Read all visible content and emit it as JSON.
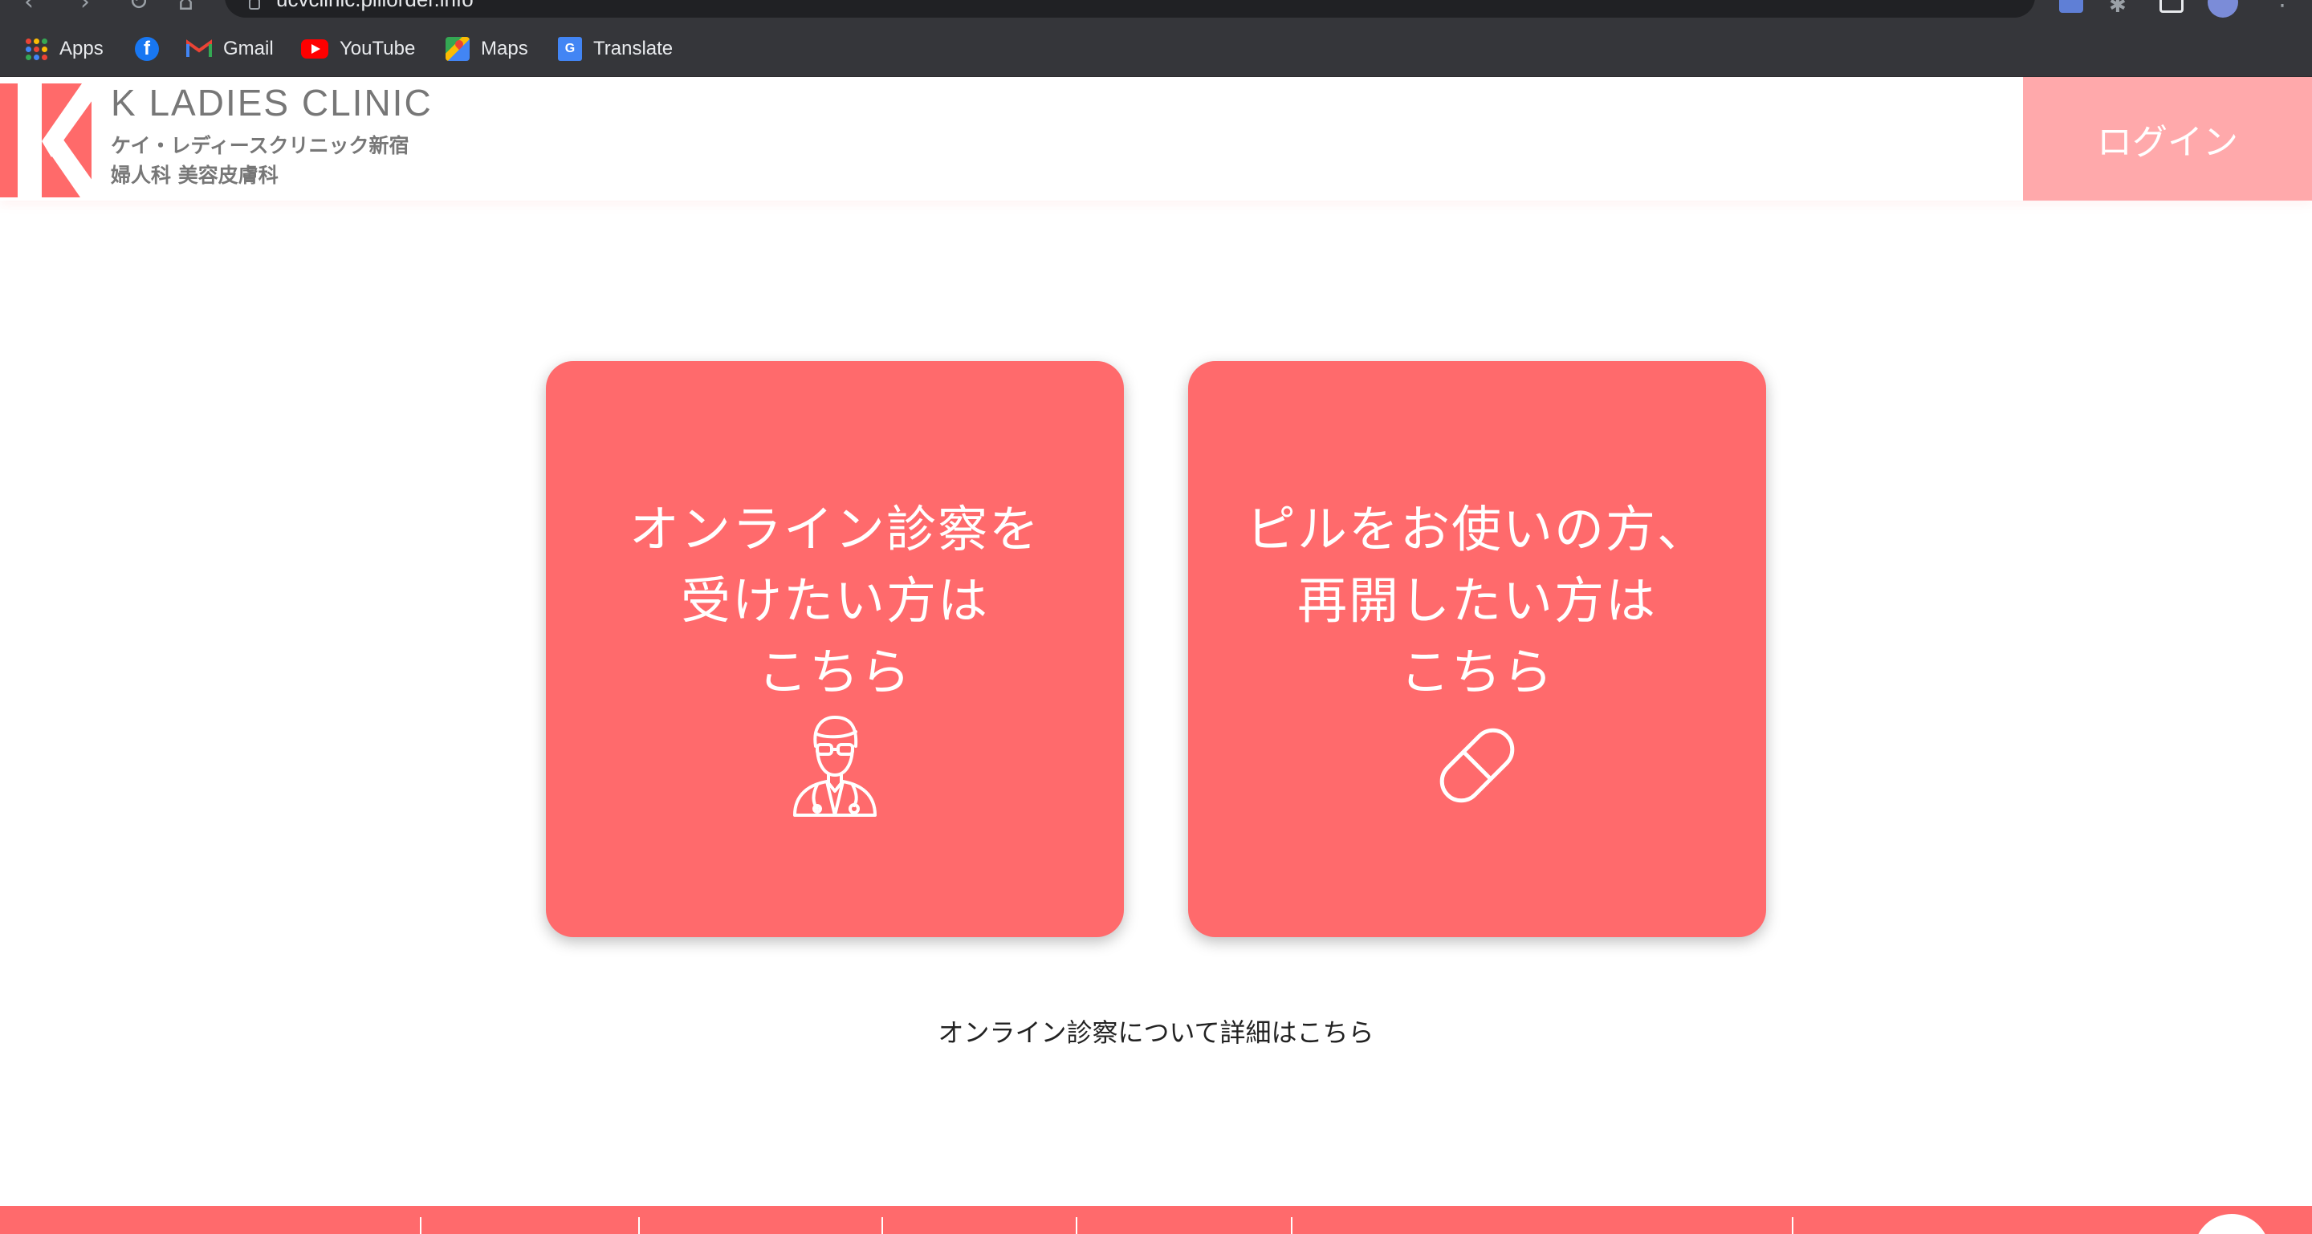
{
  "browser": {
    "url": "ucvclinic.pillorder.info",
    "bookmarks": [
      {
        "label": "Apps",
        "icon": "apps-grid-icon"
      },
      {
        "label": "",
        "icon": "facebook-icon"
      },
      {
        "label": "Gmail",
        "icon": "gmail-icon"
      },
      {
        "label": "YouTube",
        "icon": "youtube-icon"
      },
      {
        "label": "Maps",
        "icon": "maps-icon"
      },
      {
        "label": "Translate",
        "icon": "translate-icon"
      }
    ]
  },
  "header": {
    "brand_name": "K LADIES CLINIC",
    "subtitle_1": "ケイ・レディースクリニック新宿",
    "subtitle_2": "婦人科 美容皮膚科",
    "login_label": "ログイン"
  },
  "cards": [
    {
      "lines": [
        "オンライン診察を",
        "受けたい方は",
        "こちら"
      ],
      "icon": "doctor-icon"
    },
    {
      "lines": [
        "ピルをお使いの方、",
        "再開したい方は",
        "こちら"
      ],
      "icon": "pill-icon"
    }
  ],
  "details_link": "オンライン診察について詳細はこちら",
  "colors": {
    "accent": "#ff6a6c",
    "login_bg": "#ffa9ab",
    "brand_text": "#777777",
    "chrome_bg": "#35363a"
  }
}
